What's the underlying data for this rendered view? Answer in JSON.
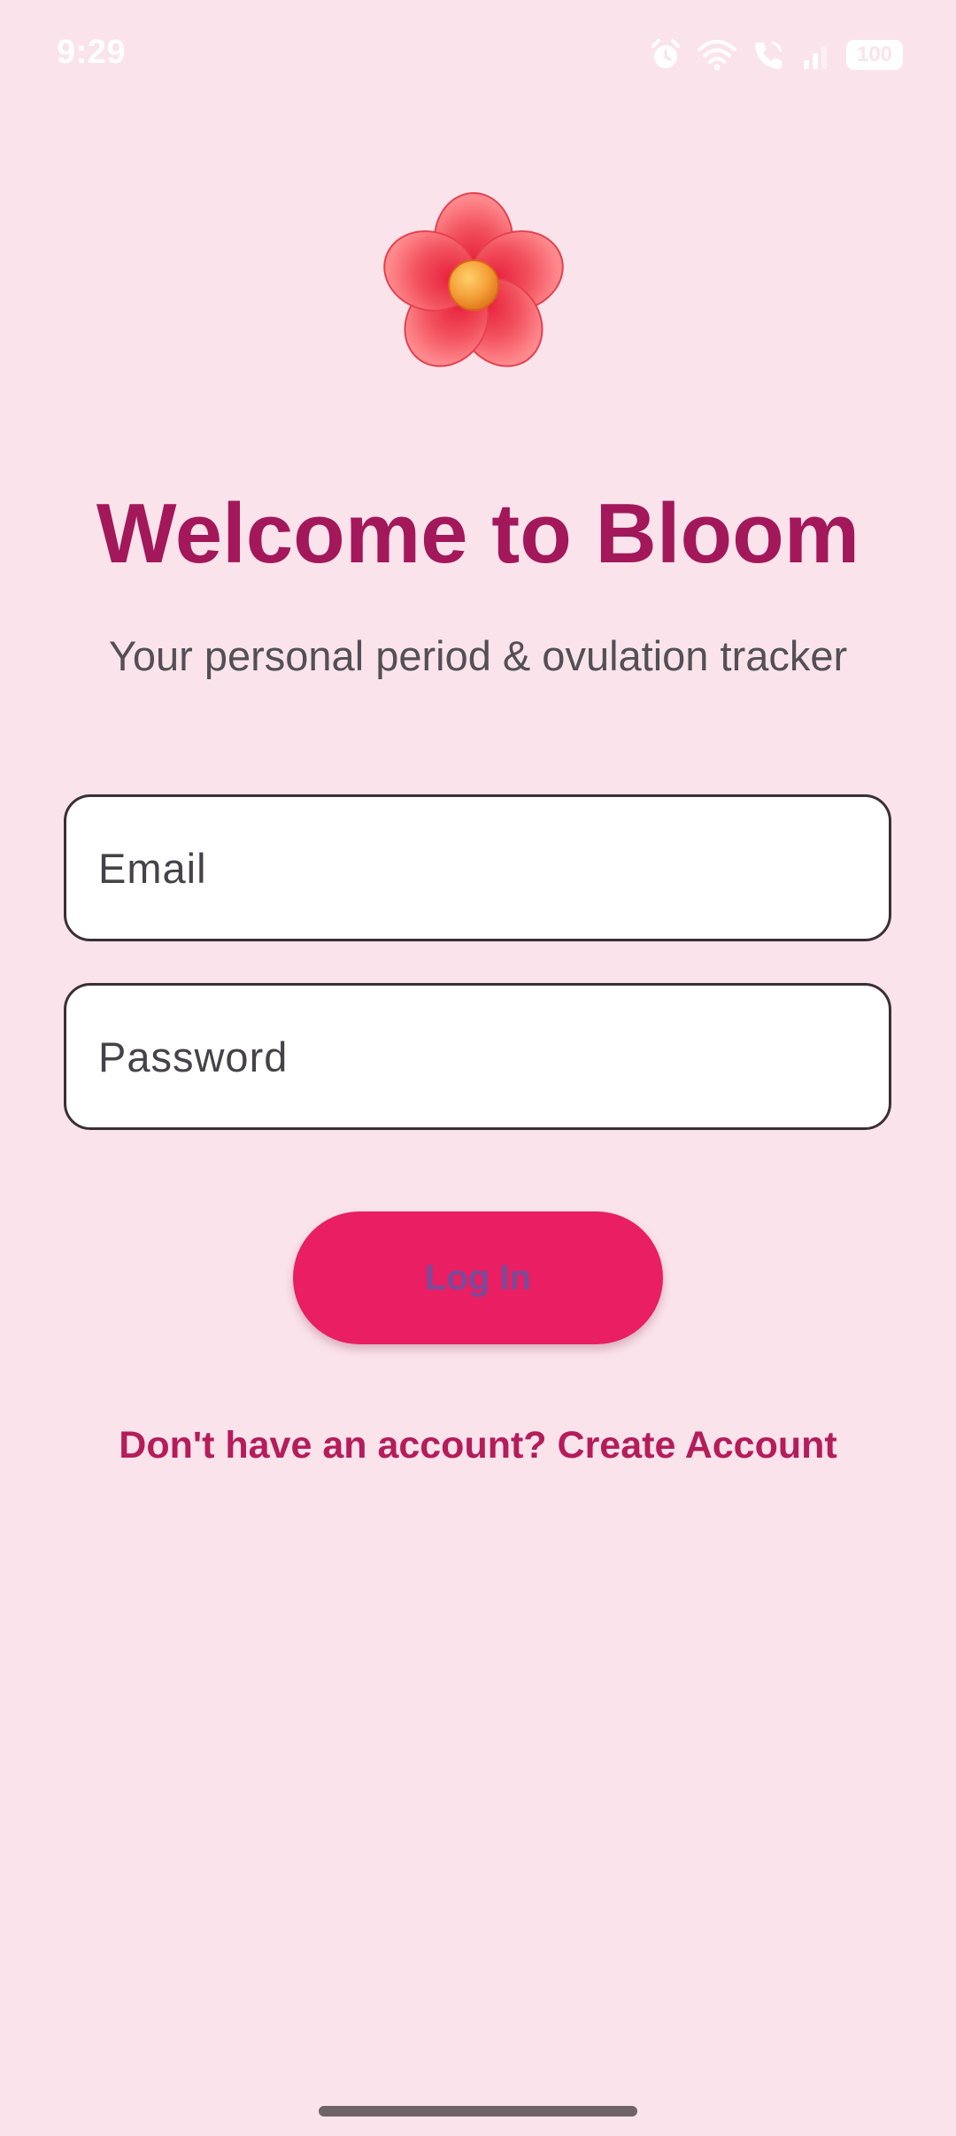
{
  "status_bar": {
    "time": "9:29",
    "icons": [
      "alarm-icon",
      "wifi-icon",
      "call-icon",
      "signal-icon",
      "battery-icon"
    ],
    "battery_level": "100"
  },
  "logo": {
    "icon": "flower-icon"
  },
  "header": {
    "title": "Welcome to Bloom",
    "subtitle": "Your personal period & ovulation tracker"
  },
  "form": {
    "email": {
      "placeholder": "Email",
      "value": ""
    },
    "password": {
      "placeholder": "Password",
      "value": ""
    },
    "login_label": "Log In",
    "signup_link": "Don't have an account? Create Account"
  },
  "colors": {
    "background": "#fbe3eb",
    "title": "#a3185a",
    "button": "#e91e63",
    "link": "#b51c5a"
  }
}
